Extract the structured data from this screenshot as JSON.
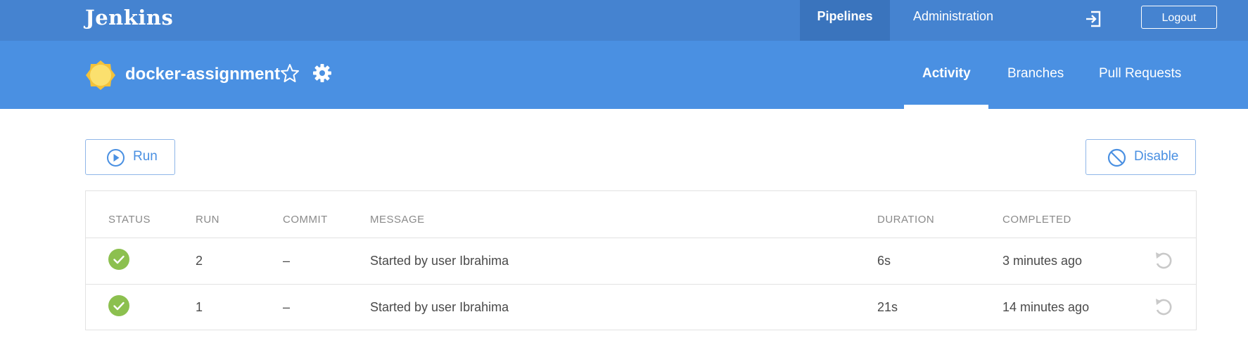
{
  "topbar": {
    "brand": "Jenkins",
    "tabs": [
      {
        "label": "Pipelines",
        "active": true
      },
      {
        "label": "Administration",
        "active": false
      }
    ],
    "logout_icon": "sign-in-icon",
    "logout_label": "Logout"
  },
  "pipeline": {
    "weather_icon": "sunny-icon",
    "name": "docker-assignment",
    "favorite_icon": "star-outline-icon",
    "settings_icon": "gear-icon",
    "tabs": [
      {
        "label": "Activity",
        "active": true
      },
      {
        "label": "Branches",
        "active": false
      },
      {
        "label": "Pull Requests",
        "active": false
      }
    ]
  },
  "actions": {
    "run_label": "Run",
    "run_icon": "play-circle-icon",
    "disable_label": "Disable",
    "disable_icon": "ban-icon"
  },
  "table": {
    "headers": [
      "STATUS",
      "RUN",
      "COMMIT",
      "MESSAGE",
      "DURATION",
      "COMPLETED"
    ],
    "rows": [
      {
        "status": "success",
        "run": "2",
        "commit": "–",
        "message": "Started by user Ibrahima",
        "duration": "6s",
        "completed": "3 minutes ago"
      },
      {
        "status": "success",
        "run": "1",
        "commit": "–",
        "message": "Started by user Ibrahima",
        "duration": "21s",
        "completed": "14 minutes ago"
      }
    ]
  },
  "colors": {
    "topbar": "#4583d0",
    "subbar": "#4a90e2",
    "accent": "#4a90e2",
    "success": "#8cc04f"
  }
}
